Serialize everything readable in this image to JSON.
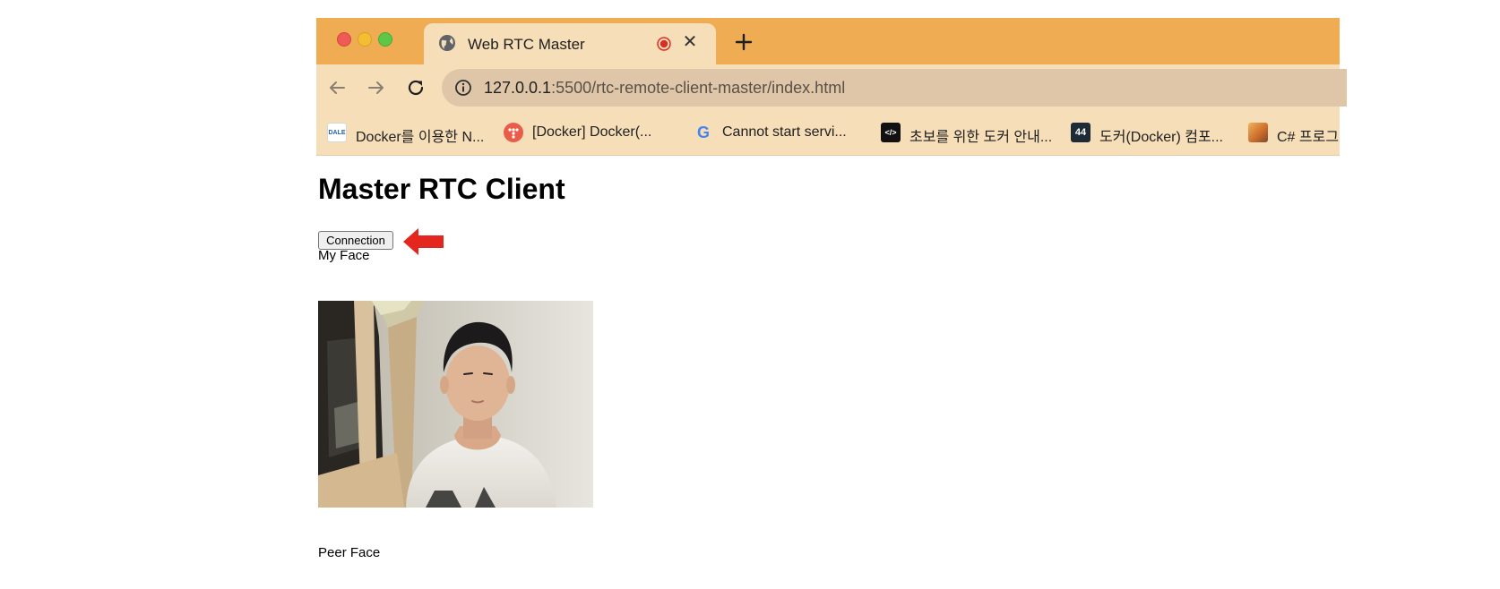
{
  "browser": {
    "tab": {
      "title": "Web RTC Master",
      "icon": "globe-icon",
      "recording_icon": "recording-icon",
      "close_icon": "close-icon"
    },
    "new_tab_icon": "plus-icon",
    "nav": {
      "back_icon": "back-arrow-icon",
      "forward_icon": "forward-arrow-icon",
      "reload_icon": "reload-icon"
    },
    "address_bar": {
      "host": "127.0.0.1",
      "rest": ":5500/rtc-remote-client-master/index.html",
      "icon": "info-icon"
    },
    "bookmarks": [
      {
        "label": "Docker를 이용한 N...",
        "icon": "dale-icon",
        "icon_text": "DALE"
      },
      {
        "label": "[Docker] Docker(...",
        "icon": "tistory-icon",
        "icon_text": ""
      },
      {
        "label": "Cannot start servi...",
        "icon": "google-icon",
        "icon_text": "G"
      },
      {
        "label": "초보를 위한 도커 안내...",
        "icon": "code-icon",
        "icon_text": "</>"
      },
      {
        "label": "도커(Docker) 컴포...",
        "icon": "site-44-icon",
        "icon_text": "44"
      },
      {
        "label": "C# 프로그래",
        "icon": "blog-icon",
        "icon_text": ""
      }
    ],
    "colors": {
      "tabbar": "#efac52",
      "toolbar": "#f6deb8",
      "omnibox": "#e0c6a8",
      "recording": "#d93025"
    }
  },
  "page": {
    "title": "Master RTC Client",
    "connection_button": "Connection",
    "annotation_icon": "red-arrow-icon",
    "annotation_color": "#e3261e",
    "my_face_label": "My Face",
    "peer_face_label": "Peer Face",
    "video_icon": "webcam-video-feed"
  }
}
